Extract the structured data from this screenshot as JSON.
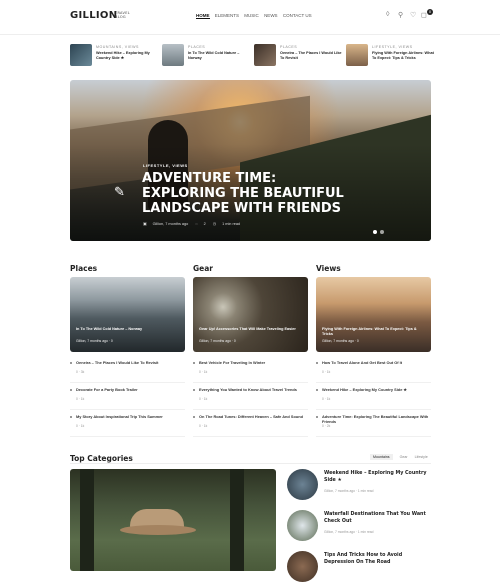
{
  "header": {
    "logo": "GILLION",
    "logo_sub": "TRAVEL BLOG",
    "menu": [
      "HOME",
      "ELEMENTS",
      "MUSIC",
      "NEWS",
      "CONTACT US"
    ],
    "cart_count": "0"
  },
  "teasers": [
    {
      "category": "MOUNTAINS, VIEWS",
      "title": "Weekend Hike – Exploring My Country Side ★",
      "color": "#3b5563"
    },
    {
      "category": "PLACES",
      "title": "In To The Wild Cold Nature – Norway",
      "color": "#7f8a92"
    },
    {
      "category": "PLACES",
      "title": "Oeneira – The Places I Would Like To Revisit",
      "color": "#5a4a3e"
    },
    {
      "category": "LIFESTYLE, VIEWS",
      "title": "Flying With Foreign Airlines: What To Expect: Tips & Tricks",
      "color": "#a58765"
    }
  ],
  "hero": {
    "category": "LIFESTYLE, VIEWS",
    "title": "ADVENTURE TIME: EXPLORING THE BEAUTIFUL LANDSCAPE WITH FRIENDS",
    "author": "Gillion, 7 months ago",
    "comments": "2",
    "read": "1 min read"
  },
  "columns": [
    {
      "heading": "Places",
      "card_title": "In To The Wild Cold Nature – Norway",
      "card_meta": "Gillion, 7 months ago",
      "card_comments": "0",
      "items": [
        {
          "title": "Oeneira – The Places I Would Like To Revisit",
          "meta": "0 · 3k"
        },
        {
          "title": "Decorate For a Party Book Trailer",
          "meta": "0 · 1k"
        },
        {
          "title": "My Story About Inspirational Trip This Summer",
          "meta": "0 · 1k"
        }
      ]
    },
    {
      "heading": "Gear",
      "card_title": "Gear Up! Accessories That Will Make Traveling Easier",
      "card_meta": "Gillion, 7 months ago",
      "card_comments": "0",
      "items": [
        {
          "title": "Best Vehicle For Traveling In Winter",
          "meta": "0 · 1k"
        },
        {
          "title": "Everything You Wanted to Know About Travel Trends",
          "meta": "0 · 1k"
        },
        {
          "title": "On The Road Tunes: Different Heaven – Safe And Sound",
          "meta": "0 · 1k"
        }
      ]
    },
    {
      "heading": "Views",
      "card_title": "Flying With Foreign Airlines: What To Expect: Tips & Tricks",
      "card_meta": "Gillion, 7 months ago",
      "card_comments": "0",
      "items": [
        {
          "title": "How To Travel Alone And Get Best Out Of It",
          "meta": "0 · 1k"
        },
        {
          "title": "Weekend Hike – Exploring My Country Side ★",
          "meta": "0 · 1k"
        },
        {
          "title": "Adventure Time: Exploring The Beautiful Landscape With Friends",
          "meta": "0 · 2k"
        }
      ]
    }
  ],
  "top_categories": {
    "heading": "Top Categories",
    "tabs": [
      "Mountains",
      "Gear",
      "Lifestyle"
    ],
    "list": [
      {
        "title": "Weekend Hike – Exploring My Country Side ★",
        "meta": "Gillion, 7 months ago · 1 min read",
        "color": "#3d4e5c"
      },
      {
        "title": "Waterfall Destinations That You Want Check Out",
        "meta": "Gillion, 7 months ago · 1 min read",
        "color": "#46523f"
      },
      {
        "title": "Tips And Tricks How to Avoid Depression On The Road",
        "meta": "",
        "color": "#6a4f3c"
      }
    ]
  }
}
